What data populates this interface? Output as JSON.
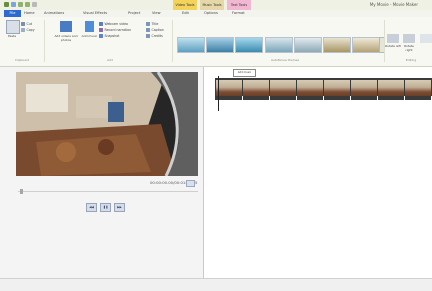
{
  "window": {
    "quick_access": [
      "save",
      "undo",
      "redo",
      "dropdown"
    ],
    "contextual_tabs": [
      "Video Tools",
      "Music Tools",
      "Text Tools"
    ],
    "title": "My Movie - Movie Maker"
  },
  "ribbon_tabs": [
    "File",
    "Home",
    "Animations",
    "Visual Effects",
    "Project",
    "View",
    "Edit",
    "Options",
    "Format"
  ],
  "ribbon": {
    "clipboard": {
      "paste": "Paste",
      "cut": "Cut",
      "copy": "Copy",
      "label": "Clipboard"
    },
    "add": {
      "add_videos": "Add videos and photos",
      "add_music": "Add music",
      "webcam": "Webcam video",
      "narration": "Record narration",
      "snapshot": "Snapshot",
      "title": "Title",
      "caption": "Caption",
      "credits": "Credits",
      "label": "Add"
    },
    "themes_label": "AutoMovie themes",
    "editing": {
      "rotate_left": "Rotate left",
      "rotate_right": "Rotate right",
      "label": "Editing"
    }
  },
  "player": {
    "time": "00:00:00.00/00:01:51.75",
    "controls": [
      "previous-frame",
      "play",
      "next-frame"
    ]
  },
  "timeline": {
    "clip_tooltip": "Add music",
    "frame_count": 8
  },
  "colors": {
    "file_tab": "#2c6cd0",
    "context_video": "#f3d35a",
    "context_music": "#e6d7a8",
    "context_text": "#f2b8d3",
    "timeline_bar": "#3a3a3a"
  }
}
